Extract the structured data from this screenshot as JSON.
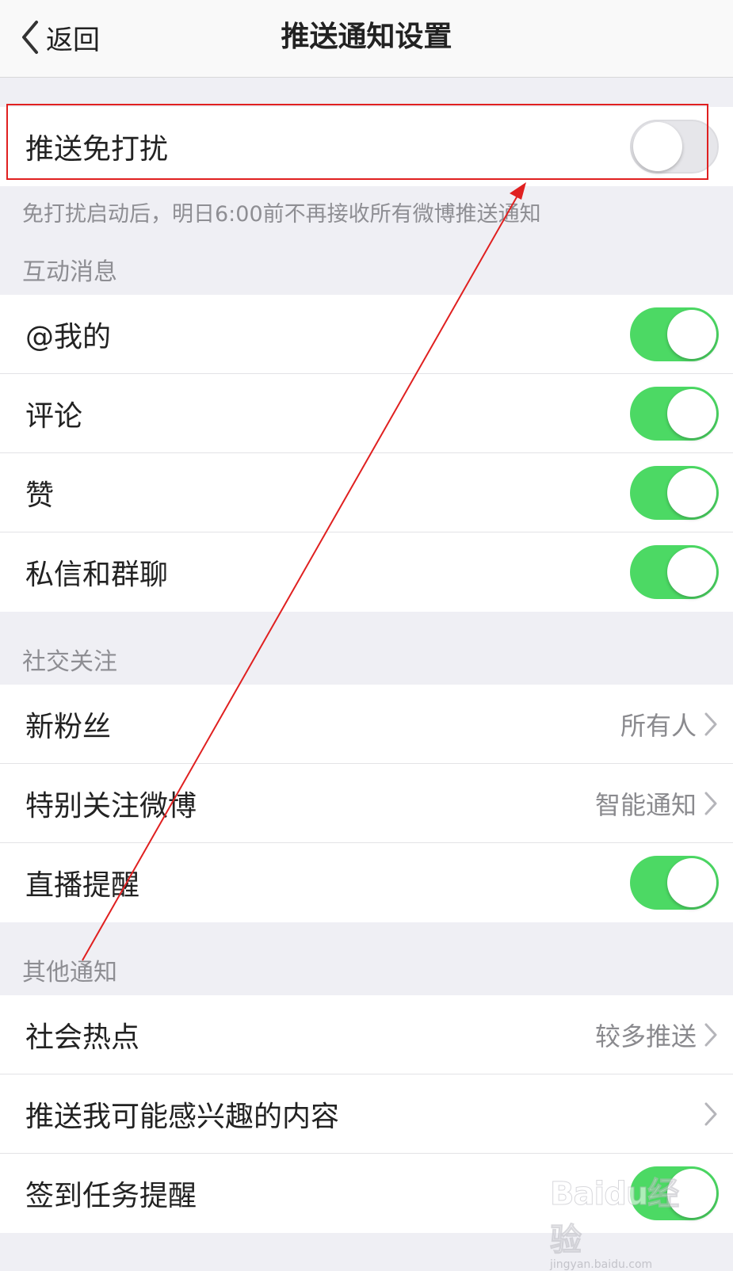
{
  "navbar": {
    "back_label": "返回",
    "title": "推送通知设置"
  },
  "dnd": {
    "label": "推送免打扰",
    "enabled": false,
    "footnote": "免打扰启动后，明日6:00前不再接收所有微博推送通知"
  },
  "sections": {
    "interaction": {
      "header": "互动消息",
      "items": [
        {
          "label": "@我的",
          "enabled": true
        },
        {
          "label": "评论",
          "enabled": true
        },
        {
          "label": "赞",
          "enabled": true
        },
        {
          "label": "私信和群聊",
          "enabled": true
        }
      ]
    },
    "social": {
      "header": "社交关注",
      "items": [
        {
          "label": "新粉丝",
          "value": "所有人"
        },
        {
          "label": "特别关注微博",
          "value": "智能通知"
        },
        {
          "label": "直播提醒",
          "enabled": true
        }
      ]
    },
    "other": {
      "header": "其他通知",
      "items": [
        {
          "label": "社会热点",
          "value": "较多推送"
        },
        {
          "label": "推送我可能感兴趣的内容",
          "value": ""
        },
        {
          "label": "签到任务提醒",
          "enabled": true
        }
      ]
    }
  },
  "colors": {
    "toggle_on": "#4cd964",
    "annotation": "#e02020",
    "background": "#efeff4"
  },
  "watermark": {
    "brand": "Baidu经验",
    "site": "jingyan.baidu.com"
  }
}
